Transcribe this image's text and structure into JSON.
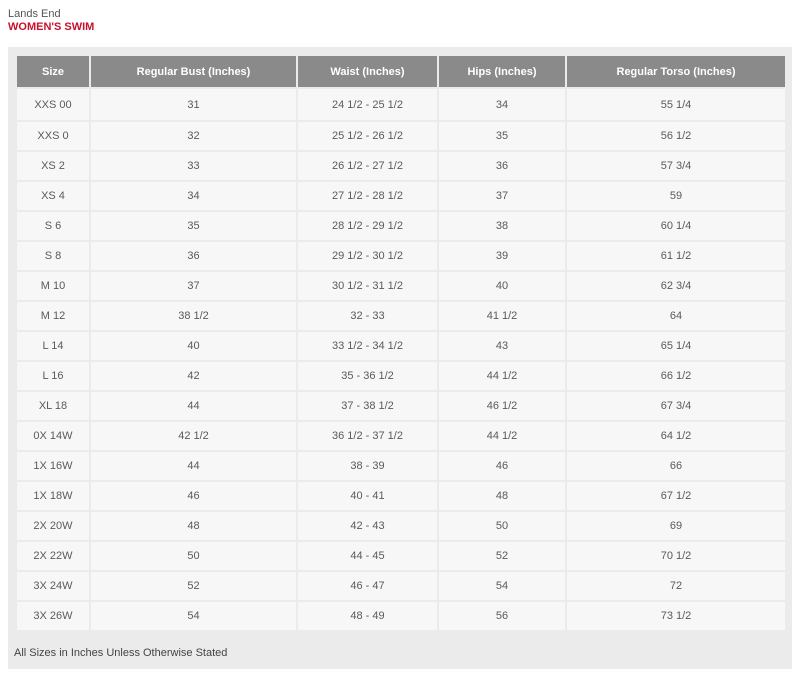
{
  "header": {
    "brand": "Lands End",
    "category": "WOMEN'S SWIM"
  },
  "table": {
    "columns": [
      "Size",
      "Regular Bust (Inches)",
      "Waist (Inches)",
      "Hips (Inches)",
      "Regular Torso (Inches)"
    ],
    "rows": [
      [
        "XXS 00",
        "31",
        "24 1/2 - 25 1/2",
        "34",
        "55 1/4"
      ],
      [
        "XXS 0",
        "32",
        "25 1/2 - 26 1/2",
        "35",
        "56 1/2"
      ],
      [
        "XS 2",
        "33",
        "26 1/2 - 27 1/2",
        "36",
        "57 3/4"
      ],
      [
        "XS 4",
        "34",
        "27 1/2 - 28 1/2",
        "37",
        "59"
      ],
      [
        "S 6",
        "35",
        "28 1/2 - 29 1/2",
        "38",
        "60 1/4"
      ],
      [
        "S 8",
        "36",
        "29 1/2 - 30 1/2",
        "39",
        "61 1/2"
      ],
      [
        "M 10",
        "37",
        "30 1/2 - 31 1/2",
        "40",
        "62 3/4"
      ],
      [
        "M 12",
        "38 1/2",
        "32 - 33",
        "41 1/2",
        "64"
      ],
      [
        "L 14",
        "40",
        "33 1/2 - 34 1/2",
        "43",
        "65 1/4"
      ],
      [
        "L 16",
        "42",
        "35 - 36 1/2",
        "44 1/2",
        "66 1/2"
      ],
      [
        "XL 18",
        "44",
        "37 - 38 1/2",
        "46 1/2",
        "67 3/4"
      ],
      [
        "0X 14W",
        "42 1/2",
        "36 1/2 - 37 1/2",
        "44 1/2",
        "64 1/2"
      ],
      [
        "1X 16W",
        "44",
        "38 - 39",
        "46",
        "66"
      ],
      [
        "1X 18W",
        "46",
        "40 - 41",
        "48",
        "67 1/2"
      ],
      [
        "2X 20W",
        "48",
        "42 - 43",
        "50",
        "69"
      ],
      [
        "2X 22W",
        "50",
        "44 - 45",
        "52",
        "70 1/2"
      ],
      [
        "3X 24W",
        "52",
        "46 - 47",
        "54",
        "72"
      ],
      [
        "3X 26W",
        "54",
        "48 - 49",
        "56",
        "73 1/2"
      ]
    ]
  },
  "footnote": "All Sizes in Inches Unless Otherwise Stated"
}
